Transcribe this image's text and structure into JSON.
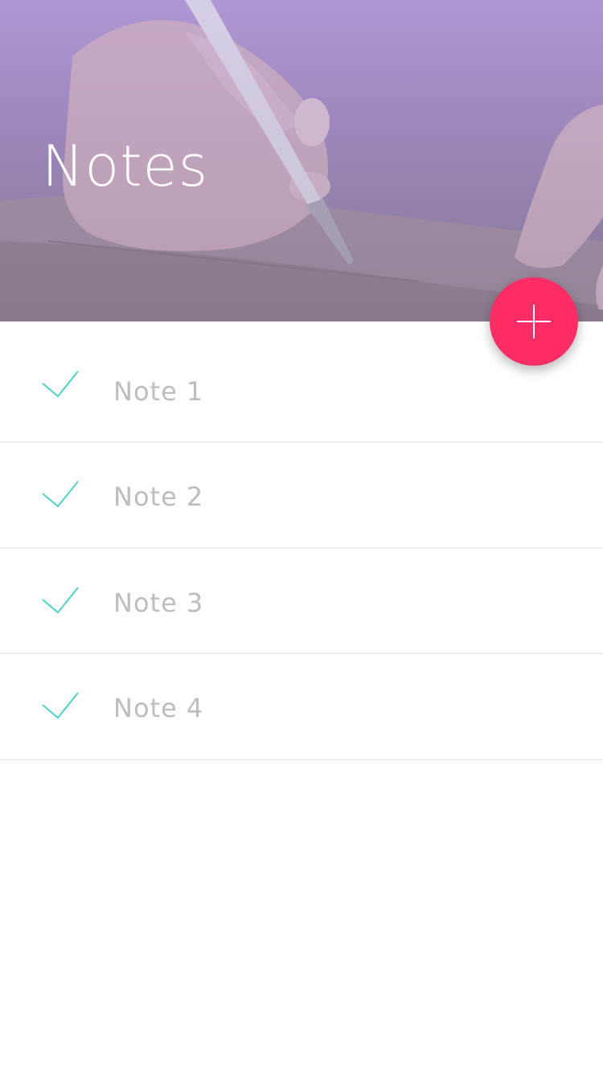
{
  "header": {
    "title": "Notes"
  },
  "fab": {
    "icon": "plus-icon",
    "color": "#ff2d66"
  },
  "notes": [
    {
      "label": "Note 1",
      "icon": "check-icon"
    },
    {
      "label": "Note 2",
      "icon": "check-icon"
    },
    {
      "label": "Note 3",
      "icon": "check-icon"
    },
    {
      "label": "Note 4",
      "icon": "check-icon"
    }
  ],
  "colors": {
    "accent_check": "#4fd1c5",
    "fab": "#ff2d66",
    "note_text": "#bdbdbd",
    "divider": "#eeeeee"
  }
}
